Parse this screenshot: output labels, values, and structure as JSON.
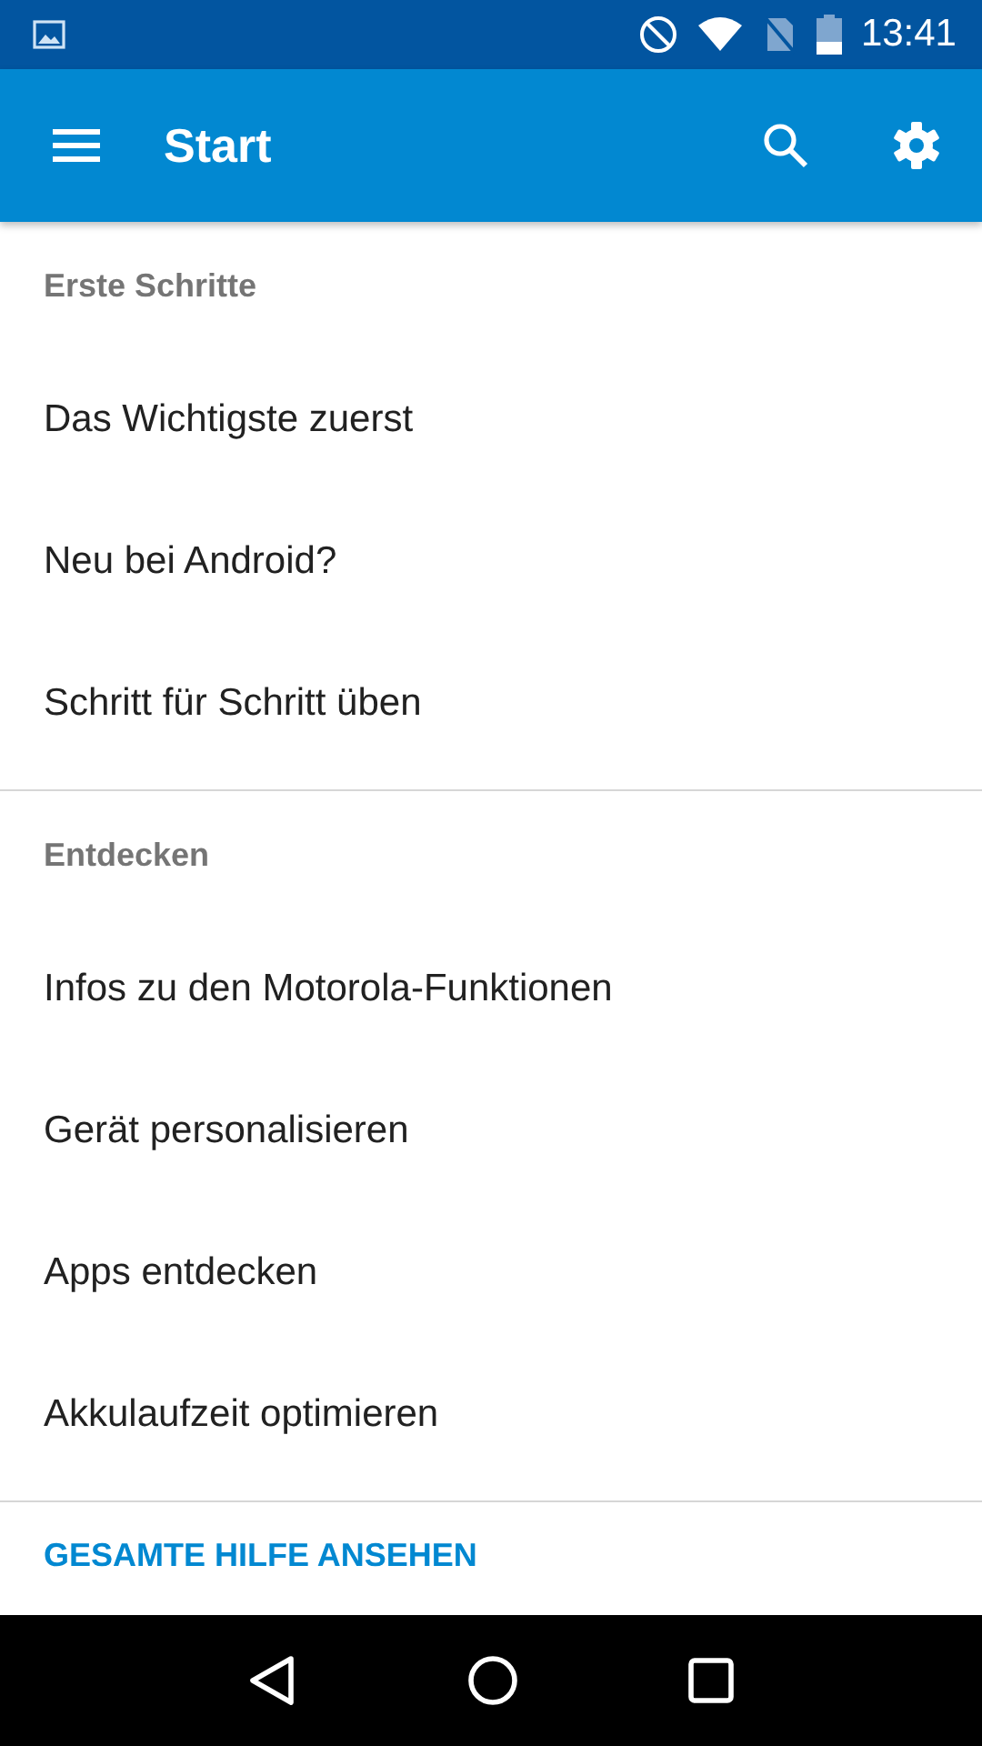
{
  "status_bar": {
    "time": "13:41"
  },
  "app_bar": {
    "title": "Start"
  },
  "sections": [
    {
      "header": "Erste Schritte",
      "items": [
        "Das Wichtigste zuerst",
        "Neu bei Android?",
        "Schritt für Schritt üben"
      ]
    },
    {
      "header": "Entdecken",
      "items": [
        "Infos zu den Motorola-Funktionen",
        "Gerät personalisieren",
        "Apps entdecken",
        "Akkulaufzeit optimieren"
      ]
    }
  ],
  "footer_link": "GESAMTE HILFE ANSEHEN"
}
